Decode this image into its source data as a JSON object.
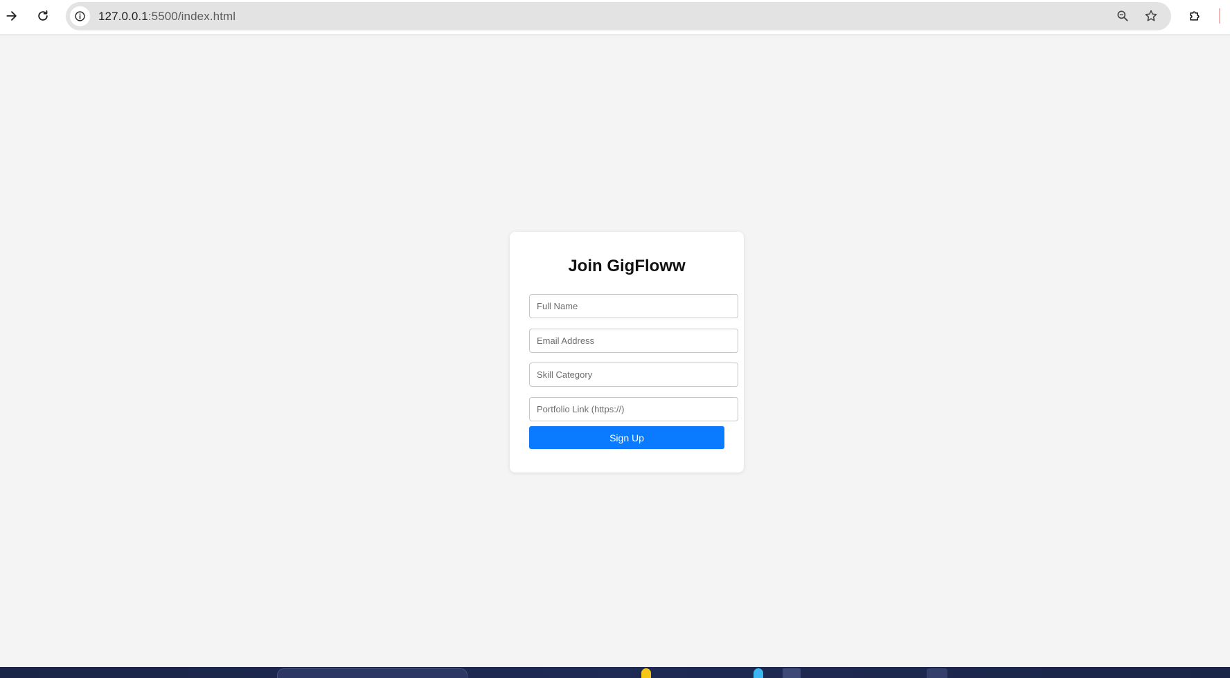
{
  "browser": {
    "url_host": "127.0.0.1",
    "url_path": ":5500/index.html",
    "icons": {
      "forward": "arrow-right-icon",
      "reload": "reload-icon",
      "site_info": "info-icon",
      "zoom": "zoom-icon",
      "bookmark": "star-icon",
      "extensions": "puzzle-icon"
    }
  },
  "signup": {
    "title": "Join GigFloww",
    "full_name_placeholder": "Full Name",
    "email_placeholder": "Email Address",
    "skill_placeholder": "Skill Category",
    "portfolio_placeholder": "Portfolio Link (https://)",
    "submit_label": "Sign Up"
  },
  "colors": {
    "page_background": "#f4f4f4",
    "card_background": "#ffffff",
    "button_background": "#0a7bff",
    "button_text": "#ffffff",
    "taskbar": "#1f2a55"
  }
}
